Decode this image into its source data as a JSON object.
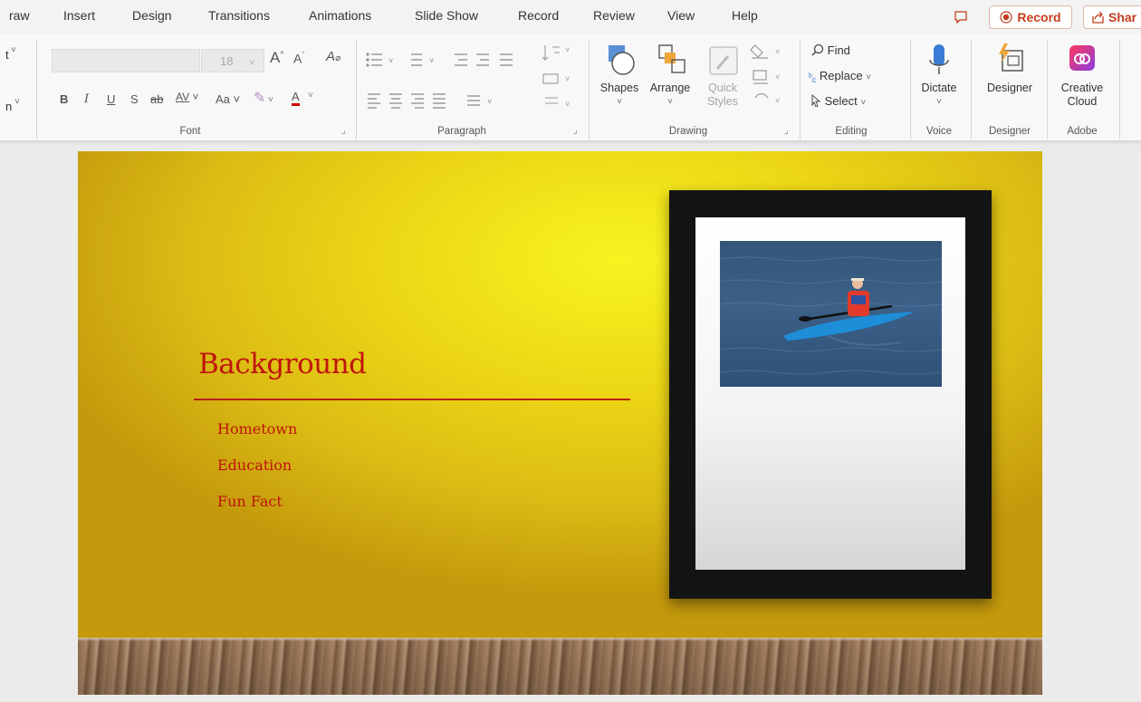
{
  "tabs": [
    "raw",
    "Insert",
    "Design",
    "Transitions",
    "Animations",
    "Slide Show",
    "Record",
    "Review",
    "View",
    "Help"
  ],
  "top_right": {
    "record_label": "Record",
    "share_label": "Shar",
    "comment_icon": "comment-icon"
  },
  "ribbon": {
    "left_cut": {
      "line1": "t",
      "line2": "n"
    },
    "font": {
      "size_value": "18",
      "group_label": "Font"
    },
    "paragraph": {
      "group_label": "Paragraph"
    },
    "drawing": {
      "shapes_label": "Shapes",
      "arrange_label": "Arrange",
      "quick_styles_line1": "Quick",
      "quick_styles_line2": "Styles",
      "group_label": "Drawing"
    },
    "editing": {
      "find_label": "Find",
      "replace_label": "Replace",
      "select_label": "Select",
      "group_label": "Editing"
    },
    "voice": {
      "dictate_label": "Dictate",
      "group_label": "Voice"
    },
    "designer": {
      "designer_label": "Designer",
      "group_label": "Designer"
    },
    "adobe": {
      "cc_line1": "Creative",
      "cc_line2": "Cloud",
      "group_label": "Adobe"
    }
  },
  "slide": {
    "title": "Background",
    "bullets": [
      "Hometown",
      "Education",
      "Fun Fact"
    ]
  },
  "colors": {
    "accent": "#c43e1c",
    "slide_text": "#c0140c",
    "slide_bg": "#ecd615"
  }
}
